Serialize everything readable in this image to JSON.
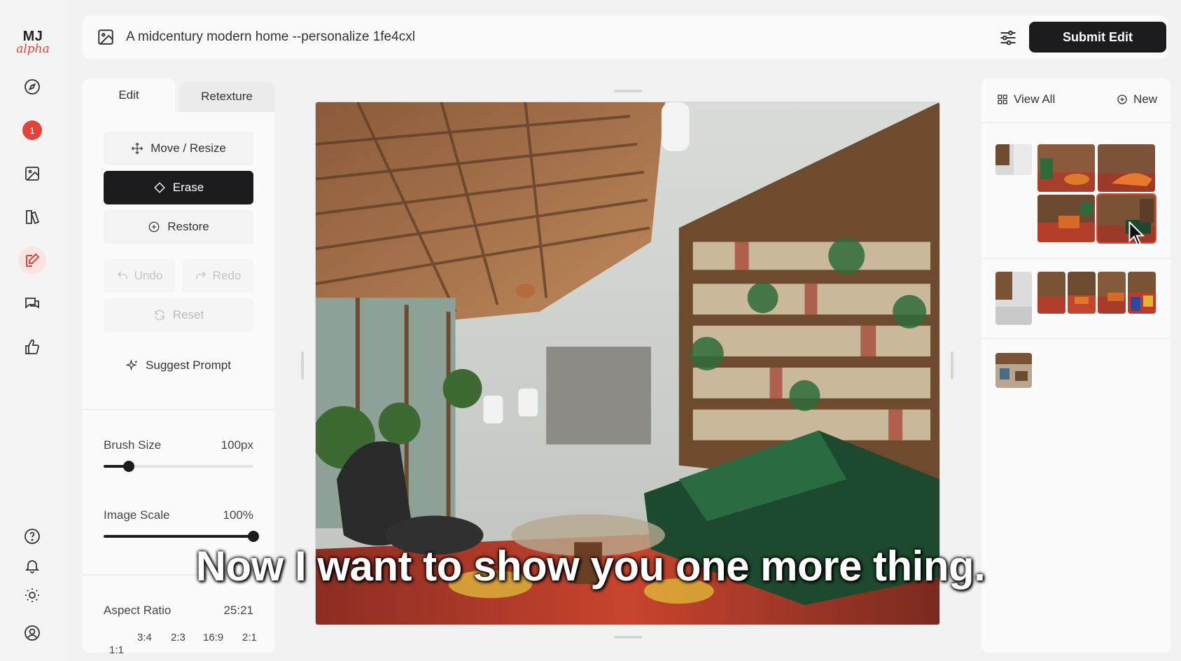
{
  "rail": {
    "logo_top": "MJ",
    "logo_bottom": "alpha",
    "notification_count": "1",
    "items": [
      "compass-icon",
      "notification-badge",
      "image-icon",
      "organize-icon",
      "edit-icon",
      "chat-icon",
      "thumbs-up-icon"
    ],
    "bottom_items": [
      "help-icon",
      "bell-icon",
      "sun-icon",
      "profile-icon"
    ]
  },
  "promptbar": {
    "prompt": "A midcentury modern home --personalize 1fe4cxl",
    "submit_label": "Submit Edit"
  },
  "toolpanel": {
    "tabs": [
      {
        "label": "Edit",
        "active": true
      },
      {
        "label": "Retexture",
        "active": false
      }
    ],
    "move_label": "Move / Resize",
    "erase_label": "Erase",
    "restore_label": "Restore",
    "undo_label": "Undo",
    "redo_label": "Redo",
    "reset_label": "Reset",
    "suggest_label": "Suggest Prompt",
    "brush": {
      "label": "Brush Size",
      "value": "100px",
      "fraction": 0.17
    },
    "scale": {
      "label": "Image Scale",
      "value": "100%",
      "fraction": 1.0
    },
    "aspect": {
      "label": "Aspect Ratio",
      "value": "25:21",
      "options": [
        "1:1",
        "3:4",
        "2:3",
        "16:9",
        "2:1"
      ]
    }
  },
  "history": {
    "view_all_label": "View All",
    "new_label": "New"
  },
  "caption": "Now I want to show you one more thing.",
  "colors": {
    "accent": "#e3443a",
    "dark_button": "#1c1c1e",
    "background": "#f2f2f3"
  }
}
